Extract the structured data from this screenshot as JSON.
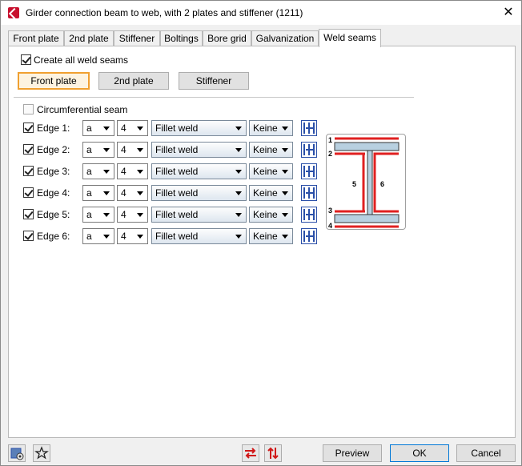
{
  "window": {
    "title": "Girder connection beam to web, with 2 plates and stiffener (1211)",
    "close_glyph": "✕"
  },
  "tabs": [
    {
      "label": "Front plate"
    },
    {
      "label": "2nd plate"
    },
    {
      "label": "Stiffener"
    },
    {
      "label": "Boltings"
    },
    {
      "label": "Bore grid"
    },
    {
      "label": "Galvanization"
    },
    {
      "label": "Weld seams",
      "active": true
    }
  ],
  "weld": {
    "create_all_label": "Create all weld seams",
    "create_all_checked": true,
    "plate_buttons": [
      {
        "label": "Front plate",
        "active": true
      },
      {
        "label": "2nd plate"
      },
      {
        "label": "Stiffener"
      }
    ],
    "circumferential_label": "Circumferential seam",
    "circumferential_checked": false,
    "edges": [
      {
        "label": "Edge 1:",
        "type": "a",
        "size": "4",
        "weld": "Fillet weld",
        "finish": "Keine"
      },
      {
        "label": "Edge 2:",
        "type": "a",
        "size": "4",
        "weld": "Fillet weld",
        "finish": "Keine"
      },
      {
        "label": "Edge 3:",
        "type": "a",
        "size": "4",
        "weld": "Fillet weld",
        "finish": "Keine"
      },
      {
        "label": "Edge 4:",
        "type": "a",
        "size": "4",
        "weld": "Fillet weld",
        "finish": "Keine"
      },
      {
        "label": "Edge 5:",
        "type": "a",
        "size": "4",
        "weld": "Fillet weld",
        "finish": "Keine"
      },
      {
        "label": "Edge 6:",
        "type": "a",
        "size": "4",
        "weld": "Fillet weld",
        "finish": "Keine"
      }
    ],
    "diagram_labels": [
      "1",
      "2",
      "3",
      "4",
      "5",
      "6"
    ]
  },
  "footer": {
    "preview_label": "Preview",
    "ok_label": "OK",
    "cancel_label": "Cancel"
  },
  "colors": {
    "accent_orange": "#f0a030",
    "weld_red": "#e02020",
    "steel_blue": "#b8d0e0",
    "icon_blue": "#2a4fa8"
  }
}
